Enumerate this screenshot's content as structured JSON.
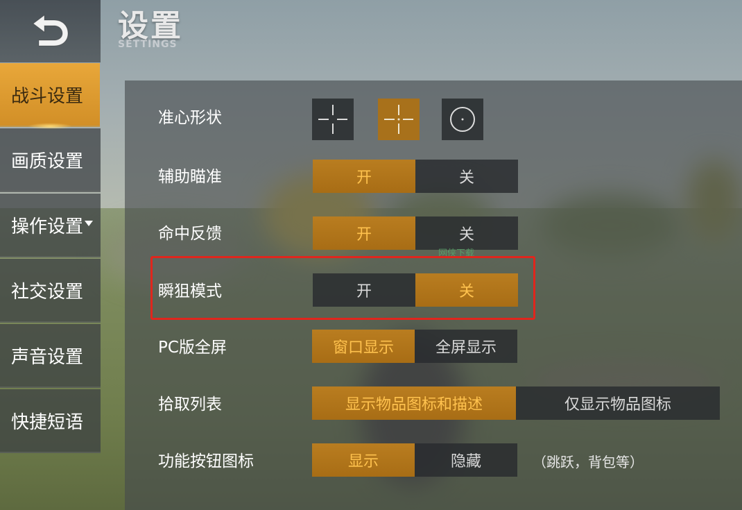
{
  "header": {
    "title": "设置",
    "subtitle": "SETTINGS"
  },
  "sidebar": {
    "items": [
      {
        "label": "战斗设置",
        "active": true
      },
      {
        "label": "画质设置",
        "active": false
      },
      {
        "label": "操作设置",
        "active": false,
        "has_dropdown": true
      },
      {
        "label": "社交设置",
        "active": false
      },
      {
        "label": "声音设置",
        "active": false
      },
      {
        "label": "快捷短语",
        "active": false
      }
    ]
  },
  "settings": {
    "crosshair": {
      "label": "准心形状",
      "options": [
        "crosshair-style-1-icon",
        "crosshair-style-2-icon",
        "crosshair-circle-icon"
      ],
      "selected_index": 1
    },
    "aim_assist": {
      "label": "辅助瞄准",
      "options": [
        "开",
        "关"
      ],
      "selected": "开"
    },
    "hit_feedback": {
      "label": "命中反馈",
      "options": [
        "开",
        "关"
      ],
      "selected": "开"
    },
    "quick_scope": {
      "label": "瞬狙模式",
      "options": [
        "开",
        "关"
      ],
      "selected": "关"
    },
    "pc_fullscreen": {
      "label": "PC版全屏",
      "options": [
        "窗口显示",
        "全屏显示"
      ],
      "selected": "窗口显示"
    },
    "pickup_list": {
      "label": "拾取列表",
      "options": [
        "显示物品图标和描述",
        "仅显示物品图标"
      ],
      "selected": "显示物品图标和描述"
    },
    "function_button_icons": {
      "label": "功能按钮图标",
      "options": [
        "显示",
        "隐藏"
      ],
      "selected": "显示",
      "note": "（跳跃，背包等）"
    }
  },
  "watermark": "网侠下载",
  "colors": {
    "accent": "#ffc24e",
    "active_bg": "#a86d15",
    "highlight": "#e0261d"
  }
}
